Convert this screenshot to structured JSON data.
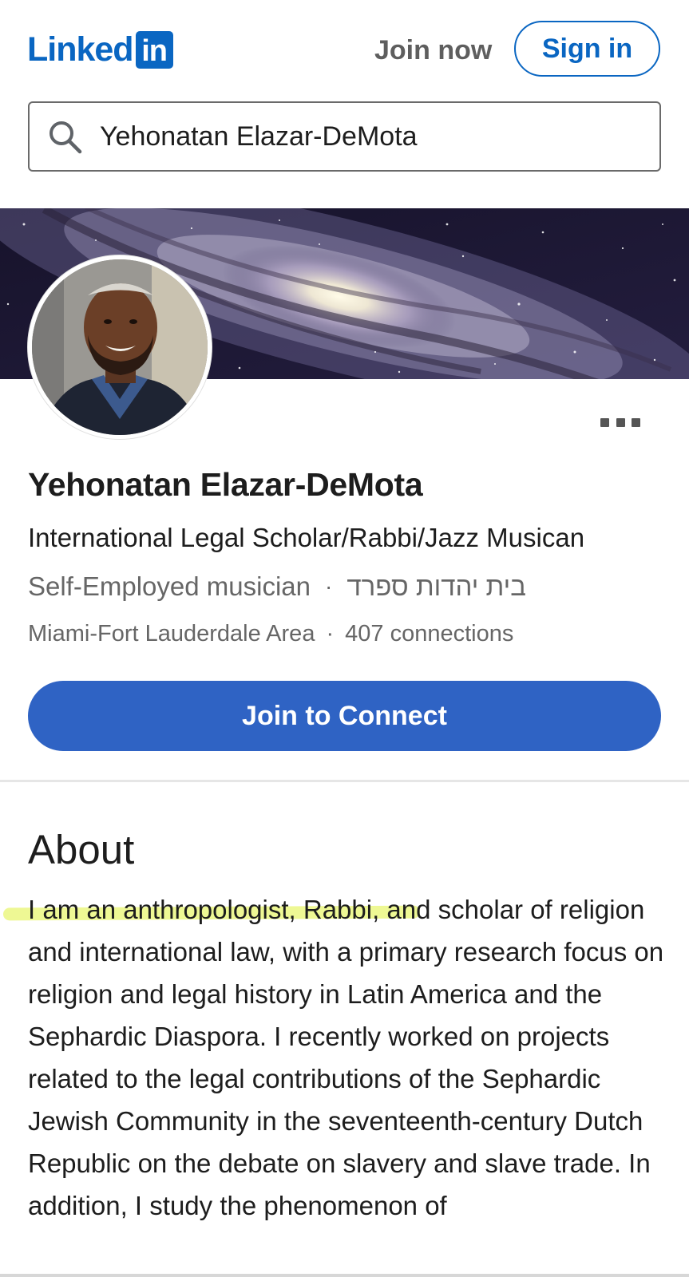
{
  "header": {
    "logo_text": "Linked",
    "logo_box": "in",
    "join_now": "Join now",
    "sign_in": "Sign in"
  },
  "search": {
    "value": "Yehonatan Elazar-DeMota"
  },
  "profile": {
    "name": "Yehonatan Elazar-DeMota",
    "headline": "International Legal Scholar/Rabbi/Jazz Musican",
    "company": "Self-Employed musician",
    "education": "בית יהדות ספרד",
    "location": "Miami-Fort Lauderdale Area",
    "connections": "407 connections",
    "separator": "·"
  },
  "actions": {
    "connect_label": "Join to Connect"
  },
  "about": {
    "title": "About",
    "text": "I am an anthropologist, Rabbi, and scholar of religion and international law, with a primary research focus on religion and legal history in Latin America and the Sephardic Diaspora. I recently worked on projects related to the legal contributions of the Sephardic Jewish Community in the seventeenth-century Dutch Republic on the debate on slavery and slave trade. In addition, I study the phenomenon of"
  },
  "colors": {
    "brand": "#0a66c2",
    "connect_button": "#2f63c4",
    "highlight": "#e8f570"
  },
  "icons": [
    "search-icon",
    "more-options-icon"
  ]
}
